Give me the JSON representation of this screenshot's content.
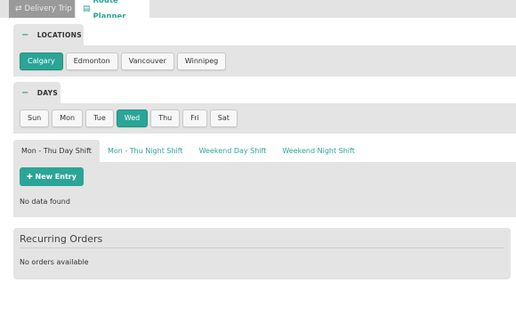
{
  "top_tabs": [
    {
      "label": "Delivery Trip",
      "icon": "swap-arrows-icon"
    },
    {
      "label": "Route Planner",
      "icon": "calendar-icon"
    }
  ],
  "locations": {
    "header": "LOCATIONS",
    "items": [
      "Calgary",
      "Edmonton",
      "Vancouver",
      "Winnipeg"
    ],
    "selected": "Calgary"
  },
  "days": {
    "header": "DAYS",
    "items": [
      "Sun",
      "Mon",
      "Tue",
      "Wed",
      "Thu",
      "Fri",
      "Sat"
    ],
    "selected": "Wed"
  },
  "shifts": {
    "tabs": [
      "Mon - Thu Day Shift",
      "Mon - Thu Night Shift",
      "Weekend Day Shift",
      "Weekend Night Shift"
    ],
    "active": "Mon - Thu Day Shift",
    "new_entry_label": "New Entry",
    "empty_text": "No data found"
  },
  "recurring_orders": {
    "title": "Recurring Orders",
    "empty_text": "No orders available"
  },
  "colors": {
    "accent": "#2aa597",
    "panel": "#e4e4e4"
  }
}
